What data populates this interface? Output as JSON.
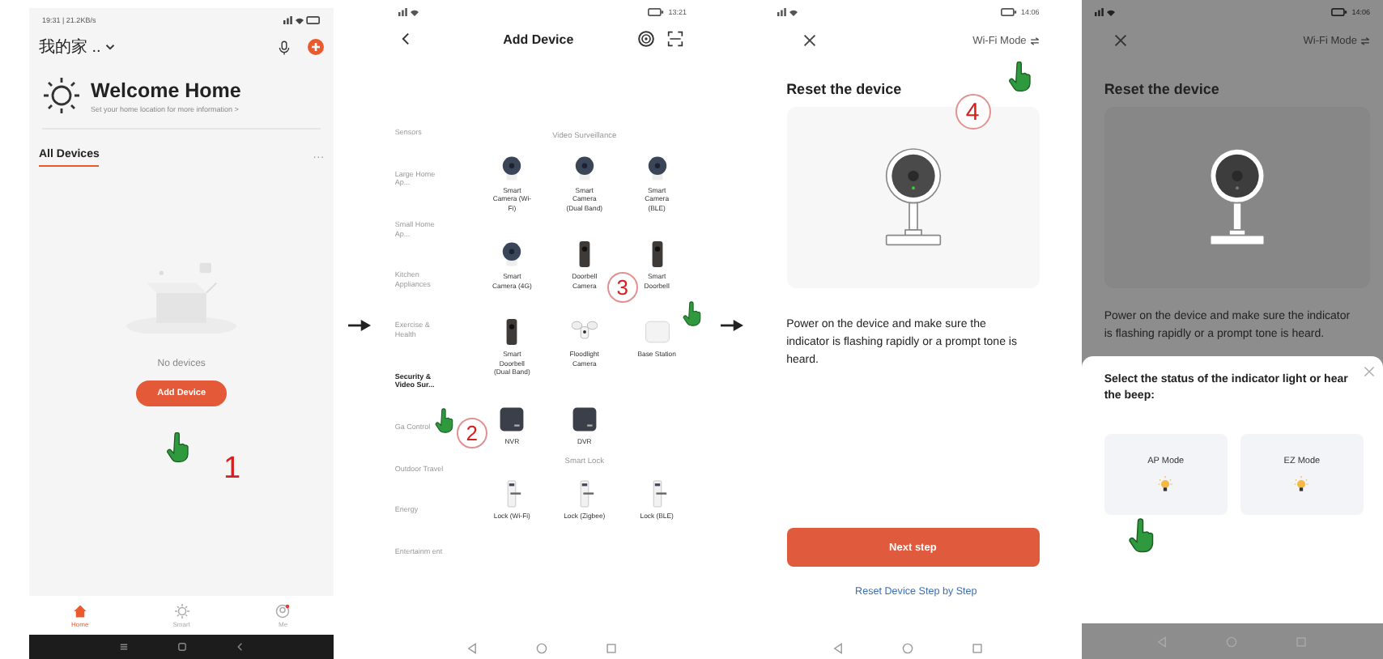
{
  "home_screen": {
    "status_time": "19:31 | 21.2KB/s",
    "home_name": "我的家 ..",
    "title": "Welcome Home",
    "subtitle": "Set your home location for more information >",
    "section_tabs": [
      {
        "label": "All Devices",
        "selected": true
      }
    ],
    "more": "···",
    "empty_text": "No devices",
    "add_button": "Add Device",
    "step": {
      "label": "1",
      "kind": "plain"
    },
    "tabs": [
      {
        "label": "Home",
        "kind": "house",
        "selected": true
      },
      {
        "label": "Smart",
        "kind": "sun",
        "selected": false
      },
      {
        "label": "Me",
        "kind": "person",
        "selected": false
      }
    ]
  },
  "add_device_screen": {
    "status_time": "13:21",
    "title": "Add Device",
    "categories": [
      {
        "label": "Sensors",
        "selected": false
      },
      {
        "label": "Large Home Ap...",
        "selected": false
      },
      {
        "label": "Small Home Ap...",
        "selected": false
      },
      {
        "label": "Kitchen Appliances",
        "selected": false
      },
      {
        "label": "Exercise & Health",
        "selected": false
      },
      {
        "label": "Security & Video Sur...",
        "selected": true
      },
      {
        "label": "Ga Control",
        "selected": false
      },
      {
        "label": "Outdoor Travel",
        "selected": false
      },
      {
        "label": "Energy",
        "selected": false
      },
      {
        "label": "Entertainm ent",
        "selected": false
      }
    ],
    "sections": [
      {
        "title": "Video Surveillance",
        "items": [
          {
            "label": "Smart Camera (Wi-Fi)",
            "kind": "camera"
          },
          {
            "label": "Smart Camera (Dual Band)",
            "kind": "camera"
          },
          {
            "label": "Smart Camera (BLE)",
            "kind": "camera"
          },
          {
            "label": "Smart Camera (4G)",
            "kind": "camera"
          },
          {
            "label": "Doorbell Camera",
            "kind": "doorbell"
          },
          {
            "label": "Smart Doorbell",
            "kind": "doorbell"
          },
          {
            "label": "Smart Doorbell (Dual Band)",
            "kind": "doorbell"
          },
          {
            "label": "Floodlight Camera",
            "kind": "floodlight"
          },
          {
            "label": "Base Station",
            "kind": "base"
          },
          {
            "label": "NVR",
            "kind": "recorder"
          },
          {
            "label": "DVR",
            "kind": "recorder"
          }
        ]
      },
      {
        "title": "Smart Lock",
        "items": [
          {
            "label": "Lock (Wi-Fi)",
            "kind": "lock"
          },
          {
            "label": "Lock (Zigbee)",
            "kind": "lock"
          },
          {
            "label": "Lock (BLE)",
            "kind": "lock"
          }
        ]
      }
    ],
    "steps": [
      {
        "label": "2",
        "kind": "circled"
      },
      {
        "label": "3",
        "kind": "circled"
      }
    ]
  },
  "reset_screen": {
    "status_time": "14:06",
    "mode_label": "Wi-Fi Mode",
    "title": "Reset the device",
    "body": "Power on the device and make sure the indicator is flashing rapidly or a prompt tone is heard.",
    "next_button": "Next step",
    "help_link": "Reset Device Step by Step",
    "step": {
      "label": "4",
      "kind": "circled"
    }
  },
  "mode_screen": {
    "status_time": "14:06",
    "mode_label": "Wi-Fi Mode",
    "title": "Reset the device",
    "body": "Power on the device and make sure the indicator is flashing rapidly or a prompt tone is heard.",
    "sheet": {
      "title": "Select the status of the indicator light or hear the beep:",
      "options": [
        {
          "label": "AP Mode"
        },
        {
          "label": "EZ Mode"
        }
      ]
    }
  }
}
